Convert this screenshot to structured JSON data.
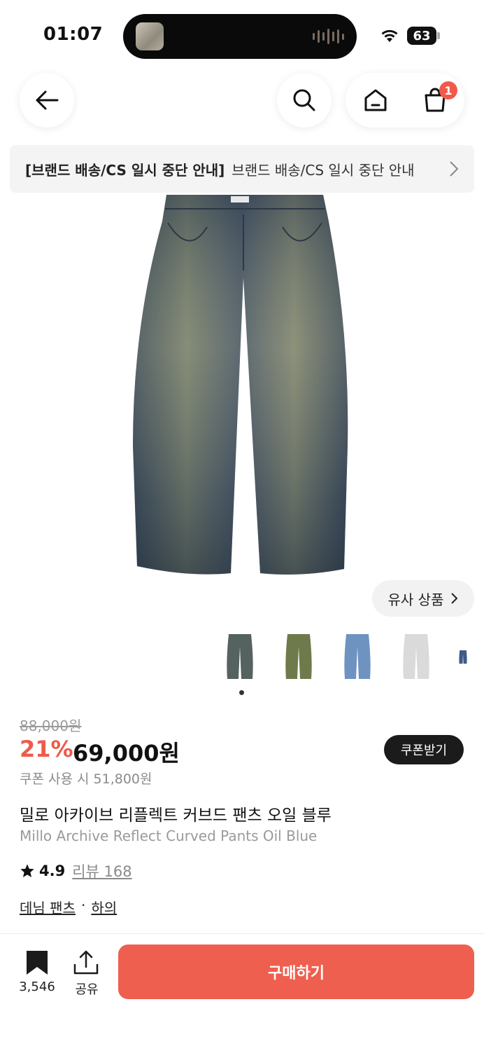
{
  "status": {
    "time": "01:07",
    "battery": "63"
  },
  "header": {
    "cart_count": "1"
  },
  "notice": {
    "bold": "[브랜드 배송/CS 일시 중단 안내]",
    "text": "브랜드 배송/CS 일시 중단 안내"
  },
  "gallery": {
    "similar_label": "유사 상품"
  },
  "pricing": {
    "original": "88,000원",
    "discount": "21%",
    "price": "69,000원",
    "coupon_button": "쿠폰받기",
    "coupon_price": "쿠폰 사용 시 51,800원"
  },
  "product": {
    "name_ko": "밀로 아카이브 리플렉트 커브드 팬츠 오일 블루",
    "name_en": "Millo Archive Reflect Curved Pants Oil Blue",
    "rating": "4.9",
    "review_label": "리뷰 168",
    "category_1": "데님 팬츠",
    "separator": "·",
    "category_2": "하의"
  },
  "bottom_bar": {
    "bookmark_count": "3,546",
    "share_label": "공유",
    "buy_label": "구매하기"
  },
  "colors": {
    "accent": "#ef5a4c",
    "dark": "#1b1b1b"
  },
  "thumbnails": [
    "oil-blue-jeans",
    "olive-jeans",
    "light-blue-jeans",
    "white-jeans",
    "dark-blue-jeans"
  ]
}
